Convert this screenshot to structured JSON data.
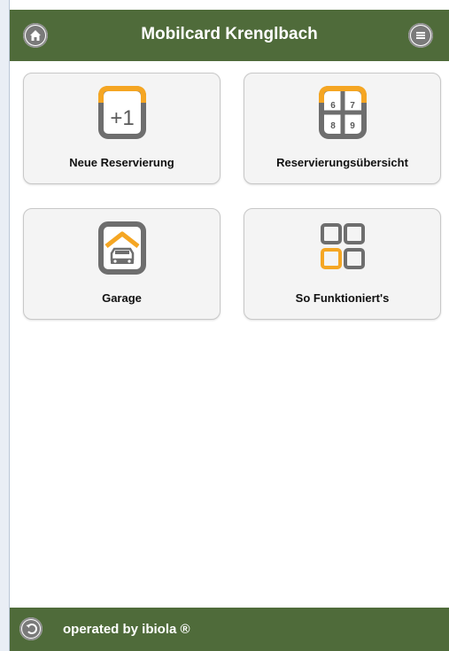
{
  "header": {
    "title": "Mobilcard Krenglbach",
    "home_icon": "home-icon",
    "menu_icon": "menu-icon"
  },
  "tiles": [
    {
      "label": "Neue Reservierung",
      "icon": "plus-one-icon",
      "icon_text": "+1"
    },
    {
      "label": "Reservierungsübersicht",
      "icon": "calendar-grid-icon",
      "grid": [
        "6",
        "7",
        "8",
        "9"
      ]
    },
    {
      "label": "Garage",
      "icon": "garage-car-icon"
    },
    {
      "label": "So Funktioniert's",
      "icon": "squares-grid-icon"
    }
  ],
  "footer": {
    "text": "operated by ibiola ®",
    "back_icon": "back-icon"
  },
  "colors": {
    "brand_green": "#4f6b3a",
    "accent_orange": "#f5a623",
    "icon_gray": "#6e6e6e"
  }
}
